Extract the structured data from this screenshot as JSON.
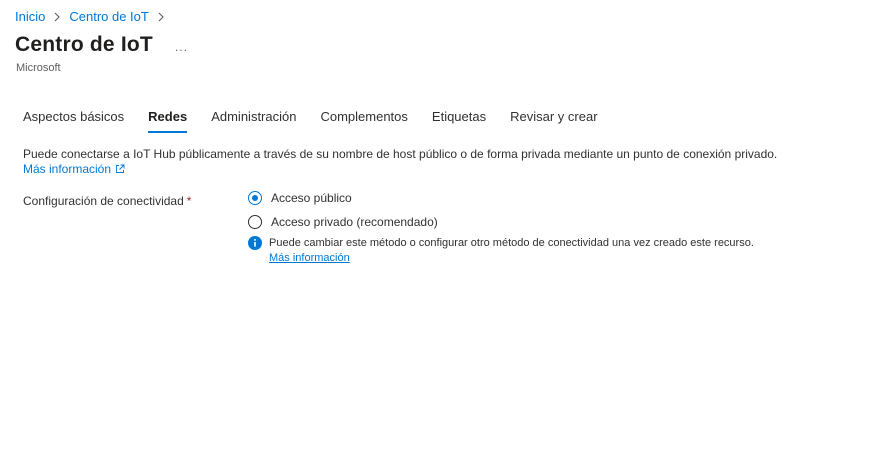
{
  "breadcrumb": {
    "home": "Inicio",
    "current": "Centro de IoT"
  },
  "header": {
    "title": "Centro de IoT",
    "more": "...",
    "subtitle": "Microsoft"
  },
  "tabs": [
    {
      "label": "Aspectos básicos",
      "active": false
    },
    {
      "label": "Redes",
      "active": true
    },
    {
      "label": "Administración",
      "active": false
    },
    {
      "label": "Complementos",
      "active": false
    },
    {
      "label": "Etiquetas",
      "active": false
    },
    {
      "label": "Revisar y crear",
      "active": false
    }
  ],
  "networking": {
    "description": "Puede conectarse a IoT Hub públicamente a través de su nombre de host público o de forma privada mediante un punto de conexión privado.",
    "learn_more": "Más información",
    "connectivity_label": "Configuración de conectividad",
    "required_mark": "*",
    "options": [
      {
        "label": "Acceso público",
        "selected": true
      },
      {
        "label": "Acceso privado (recomendado)",
        "selected": false
      }
    ],
    "info_text": "Puede cambiar este método o configurar otro método de conectividad una vez creado este recurso.",
    "info_link": "Más información"
  },
  "colors": {
    "accent": "#0078d4",
    "text": "#323130",
    "required": "#a4262c"
  },
  "icons": {
    "breadcrumb_separator": "chevron-right-icon",
    "external_link": "external-link-icon",
    "info": "info-icon"
  }
}
